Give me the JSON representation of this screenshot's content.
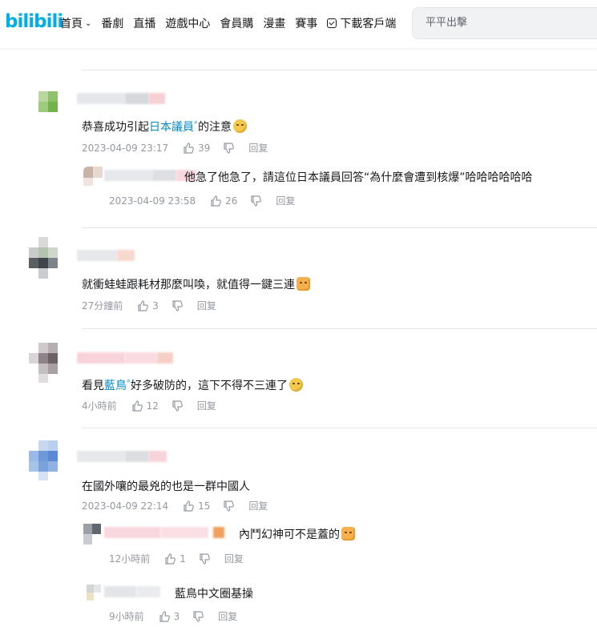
{
  "header": {
    "logo": "bilibili",
    "nav": [
      {
        "label": "首頁",
        "chevron": true
      },
      {
        "label": "番劇"
      },
      {
        "label": "直播"
      },
      {
        "label": "遊戲中心"
      },
      {
        "label": "會員購"
      },
      {
        "label": "漫畫"
      },
      {
        "label": "賽事"
      },
      {
        "label": "下載客戶端",
        "icon": "download-icon"
      }
    ],
    "search_placeholder": "平平出擊"
  },
  "comments": [
    {
      "pre": "恭喜成功引起",
      "link": "日本議員",
      "post": "的注意",
      "emoji": "blush-emoji",
      "time": "2023-04-09 23:17",
      "likes": "39",
      "reply": "回复",
      "replies": [
        {
          "text": "他急了他急了，請這位日本議員回答“為什麼會遭到核爆”哈哈哈哈哈哈",
          "time": "2023-04-09 23:58",
          "likes": "26",
          "reply": "回复"
        }
      ]
    },
    {
      "pre": "就衝蛙蛙跟耗材那麼叫喚，就值得一鍵三連",
      "link": "",
      "post": "",
      "emoji": "cat-emoji",
      "time": "27分鐘前",
      "likes": "3",
      "reply": "回复"
    },
    {
      "pre": "看見",
      "link": "藍鳥",
      "post": "好多破防的，這下不得不三連了",
      "emoji": "smirk-emoji",
      "time": "4小時前",
      "likes": "12",
      "reply": "回复"
    },
    {
      "pre": "在國外嚷的最兇的也是一群中國人",
      "link": "",
      "post": "",
      "emoji": "",
      "time": "2023-04-09 22:14",
      "likes": "15",
      "reply": "回复",
      "replies": [
        {
          "text": "內鬥幻神可不是蓋的",
          "emoji": "cat-emoji",
          "time": "12小時前",
          "likes": "1",
          "reply": "回复"
        },
        {
          "text": "藍鳥中文圈基操",
          "time": "9小時前",
          "likes": "3",
          "reply": "回复"
        }
      ]
    }
  ],
  "colors": {
    "accent": "#00aeec",
    "link": "#008ac5",
    "meta": "#9499a0",
    "divider": "#e3e5e7"
  }
}
